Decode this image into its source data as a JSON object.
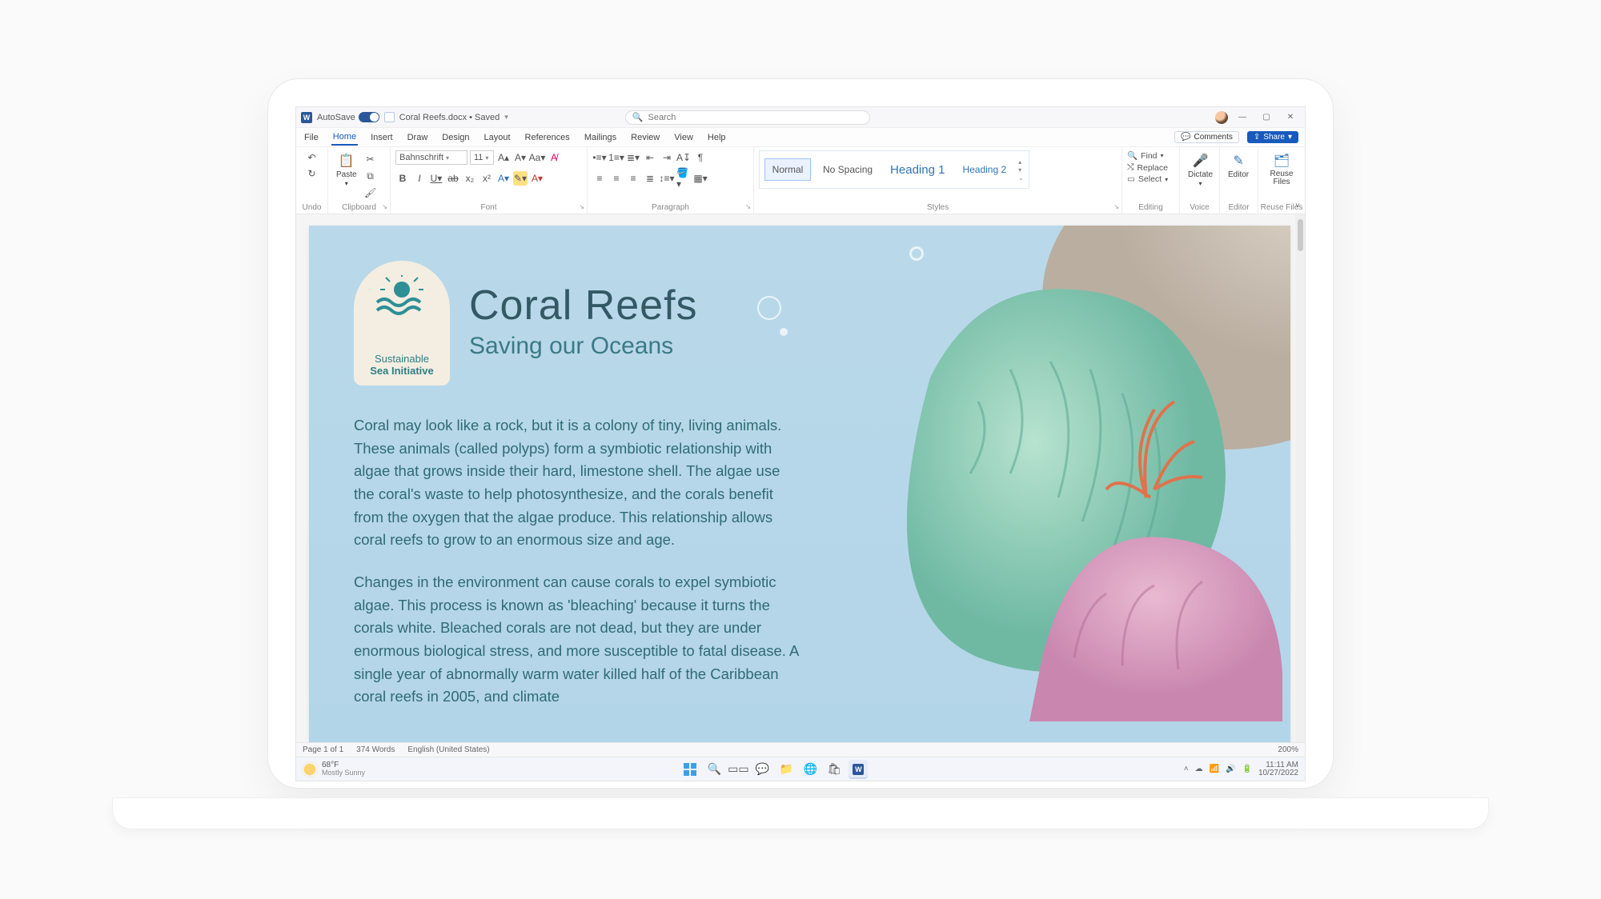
{
  "titlebar": {
    "autosave_label": "AutoSave",
    "autosave_state": "On",
    "doc_name": "Coral Reefs.docx",
    "save_state": "Saved",
    "search_placeholder": "Search"
  },
  "window_controls": {
    "min": "—",
    "max": "▢",
    "close": "✕"
  },
  "menu": {
    "tabs": [
      "File",
      "Home",
      "Insert",
      "Draw",
      "Design",
      "Layout",
      "References",
      "Mailings",
      "Review",
      "View",
      "Help"
    ],
    "active": "Home",
    "comments_label": "Comments",
    "share_label": "Share"
  },
  "ribbon": {
    "groups": {
      "undo": "Undo",
      "clipboard": {
        "title": "Clipboard",
        "paste": "Paste"
      },
      "font": {
        "title": "Font",
        "name": "Bahnschrift",
        "size": "11"
      },
      "paragraph": {
        "title": "Paragraph"
      },
      "styles": {
        "title": "Styles",
        "items": [
          "Normal",
          "No Spacing",
          "Heading 1",
          "Heading 2"
        ]
      },
      "editing": {
        "title": "Editing",
        "find": "Find",
        "replace": "Replace",
        "select": "Select"
      },
      "voice": {
        "title": "Voice",
        "dictate": "Dictate"
      },
      "editor": {
        "title": "Editor",
        "editor_btn": "Editor"
      },
      "reuse": {
        "title": "Reuse Files",
        "btn": "Reuse Files"
      }
    }
  },
  "document": {
    "logo_line1": "Sustainable",
    "logo_line2": "Sea Initiative",
    "title": "Coral Reefs",
    "subtitle": "Saving our Oceans",
    "para1": "Coral may look like a rock, but it is a colony of tiny, living animals. These animals (called polyps) form a symbiotic relationship with algae that grows inside their hard, limestone shell. The algae use the coral's waste to help photosynthesize, and the corals benefit from the oxygen that the algae produce. This relationship allows coral reefs to grow to an enormous size and age.",
    "para2": "Changes in the environment can cause corals to expel symbiotic algae. This process is known as 'bleaching' because it turns the corals white. Bleached corals are not dead, but they are under enormous biological stress, and more susceptible to fatal disease. A single year of abnormally warm water killed half of the Caribbean coral reefs in 2005, and climate"
  },
  "statusbar": {
    "page": "Page 1 of 1",
    "words": "374 Words",
    "lang": "English (United States)",
    "zoom": "200%"
  },
  "taskbar": {
    "weather_temp": "68°F",
    "weather_text": "Mostly Sunny",
    "time": "11:11 AM",
    "date": "10/27/2022",
    "tray_chevron": "˄"
  }
}
